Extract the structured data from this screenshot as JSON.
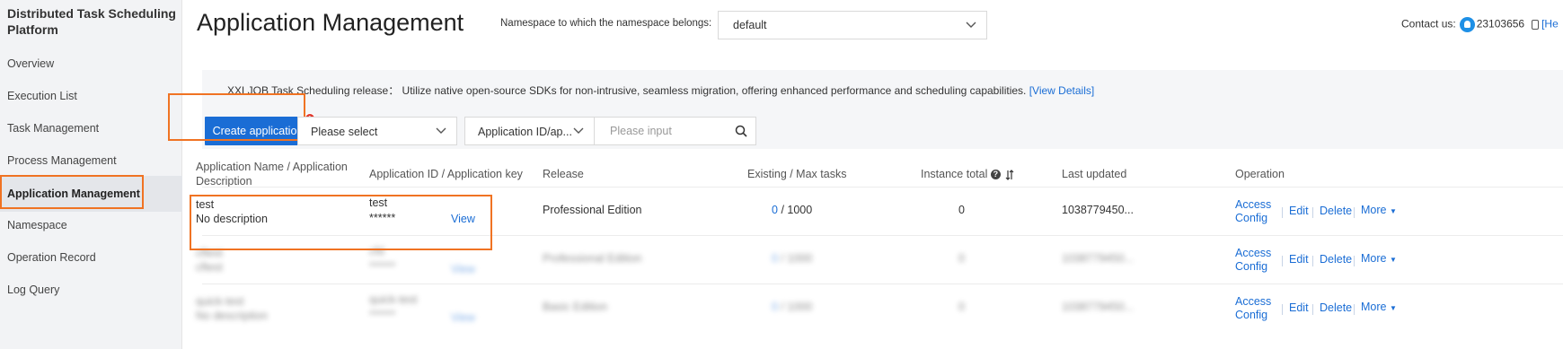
{
  "sidebar": {
    "title": "Distributed Task Scheduling Platform",
    "items": [
      {
        "label": "Overview"
      },
      {
        "label": "Execution List"
      },
      {
        "label": "Task Management"
      },
      {
        "label": "Process Management"
      },
      {
        "label": "Application Management"
      },
      {
        "label": "Namespace"
      },
      {
        "label": "Operation Record"
      },
      {
        "label": "Log Query"
      }
    ]
  },
  "header": {
    "title": "Application Management",
    "namespace_label": "Namespace to which the namespace belongs:",
    "namespace_value": "default",
    "contact_label": "Contact us:",
    "contact_qq": "23103656",
    "help_link": "[He"
  },
  "notice": {
    "text": "XXLJOB Task Scheduling release： Utilize native open-source SDKs for non-intrusive, seamless migration, offering enhanced performance and scheduling capabilities.",
    "link": "[View Details]"
  },
  "toolbar": {
    "create_label": "Create application",
    "badge": "1",
    "select_placeholder": "Please select",
    "filter_field": "Application ID/ap...",
    "search_placeholder": "Please input"
  },
  "table": {
    "headers": {
      "name": "Application Name / Application Description",
      "id": "Application ID / Application key",
      "release": "Release",
      "tasks": "Existing / Max tasks",
      "instances": "Instance total",
      "updated": "Last updated",
      "operation": "Operation"
    },
    "rows": [
      {
        "name": "test",
        "desc": "No description",
        "app_id": "test",
        "app_key": "******",
        "view": "View",
        "release": "Professional Edition",
        "existing": "0",
        "max": "/ 1000",
        "instances": "0",
        "updated": "1038779450...",
        "access": "Access Config",
        "edit": "Edit",
        "delete": "Delete",
        "more": "More"
      },
      {
        "name": "cftest",
        "desc": "cftest",
        "app_id": "cfd",
        "app_key": "******",
        "view": "View",
        "release": "Professional Edition",
        "existing": "0",
        "max": "/ 1000",
        "instances": "0",
        "updated": "1038779450...",
        "access": "Access Config",
        "edit": "Edit",
        "delete": "Delete",
        "more": "More"
      },
      {
        "name": "quick-test",
        "desc": "No description",
        "app_id": "quick-test",
        "app_key": "******",
        "view": "View",
        "release": "Basic Edition",
        "existing": "0",
        "max": "/ 1000",
        "instances": "0",
        "updated": "1038779450...",
        "access": "Access Config",
        "edit": "Edit",
        "delete": "Delete",
        "more": "More"
      }
    ]
  },
  "colors": {
    "accent": "#1a6dd5",
    "highlight": "#f07323",
    "badge": "#e0392e"
  }
}
